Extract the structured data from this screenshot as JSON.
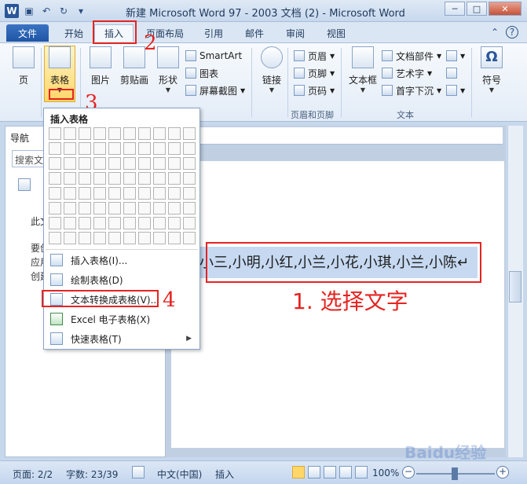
{
  "window": {
    "title": "新建 Microsoft Word 97 - 2003 文档 (2)  -  Microsoft Word",
    "minimize": "─",
    "maximize": "□",
    "close": "✕"
  },
  "tabs": [
    "文件",
    "开始",
    "插入",
    "页面布局",
    "引用",
    "邮件",
    "审阅",
    "视图"
  ],
  "annotations": {
    "step1": "1. 选择文字",
    "step2": "2",
    "step3": "3",
    "step4": "4"
  },
  "ribbon": {
    "page": "页",
    "table": "表格",
    "picture": "图片",
    "clipart": "剪贴画",
    "shapes": "形状",
    "smartart": "SmartArt",
    "chart": "图表",
    "screenshot": "屏幕截图",
    "link": "链接",
    "header": "页眉",
    "footer": "页脚",
    "page_number": "页码",
    "header_footer_group": "页眉和页脚",
    "textbox": "文本框",
    "quick_parts": "文档部件",
    "wordart": "艺术字",
    "dropcap": "首字下沉",
    "text_group": "文本",
    "symbol": "符号"
  },
  "dropdown": {
    "title": "插入表格",
    "items": [
      {
        "label": "插入表格(I)..."
      },
      {
        "label": "绘制表格(D)"
      },
      {
        "label": "文本转换成表格(V)..."
      },
      {
        "label": "Excel 电子表格(X)"
      },
      {
        "label": "快速表格(T)"
      }
    ]
  },
  "nav": {
    "title": "导航",
    "search_placeholder": "搜索文",
    "line1": "此文",
    "line2": "要创",
    "line3": "应用",
    "line4": "创建"
  },
  "document": {
    "text": "小三,小明,小红,小兰,小花,小琪,小兰,小陈↵"
  },
  "status": {
    "page": "页面: 2/2",
    "words": "字数: 23/39",
    "language": "中文(中国)",
    "mode": "插入",
    "zoom": "100%"
  },
  "watermark": "Baidu经验"
}
